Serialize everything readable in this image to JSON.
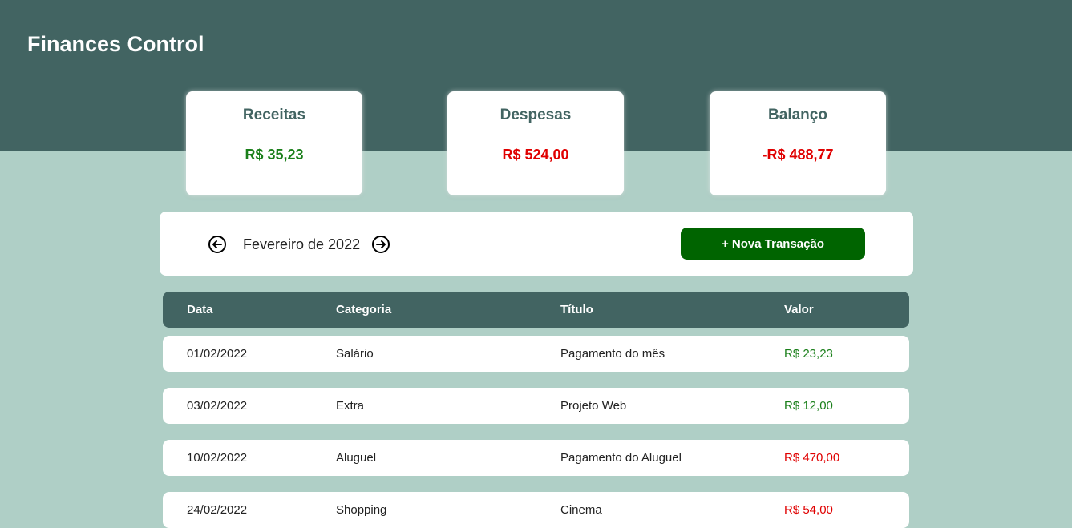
{
  "app": {
    "title": "Finances Control"
  },
  "colors": {
    "header_bg": "#426462",
    "page_bg": "#afcfc6",
    "income": "#1a7f1a",
    "expense": "#e00000",
    "button_bg": "#006400"
  },
  "summary": {
    "income": {
      "label": "Receitas",
      "value": "R$ 35,23"
    },
    "expenses": {
      "label": "Despesas",
      "value": "R$ 524,00"
    },
    "balance": {
      "label": "Balanço",
      "value": "-R$ 488,77"
    }
  },
  "toolbar": {
    "prev_icon": "arrow-left-circle-icon",
    "next_icon": "arrow-right-circle-icon",
    "month": "Fevereiro de 2022",
    "add_label": "+ Nova Transação"
  },
  "table": {
    "headers": {
      "date": "Data",
      "category": "Categoria",
      "title": "Título",
      "value": "Valor"
    },
    "rows": [
      {
        "date": "01/02/2022",
        "category": "Salário",
        "title": "Pagamento do mês",
        "value": "R$ 23,23",
        "type": "income"
      },
      {
        "date": "03/02/2022",
        "category": "Extra",
        "title": "Projeto Web",
        "value": "R$ 12,00",
        "type": "income"
      },
      {
        "date": "10/02/2022",
        "category": "Aluguel",
        "title": "Pagamento do Aluguel",
        "value": "R$ 470,00",
        "type": "expense"
      },
      {
        "date": "24/02/2022",
        "category": "Shopping",
        "title": "Cinema",
        "value": "R$ 54,00",
        "type": "expense"
      }
    ]
  }
}
